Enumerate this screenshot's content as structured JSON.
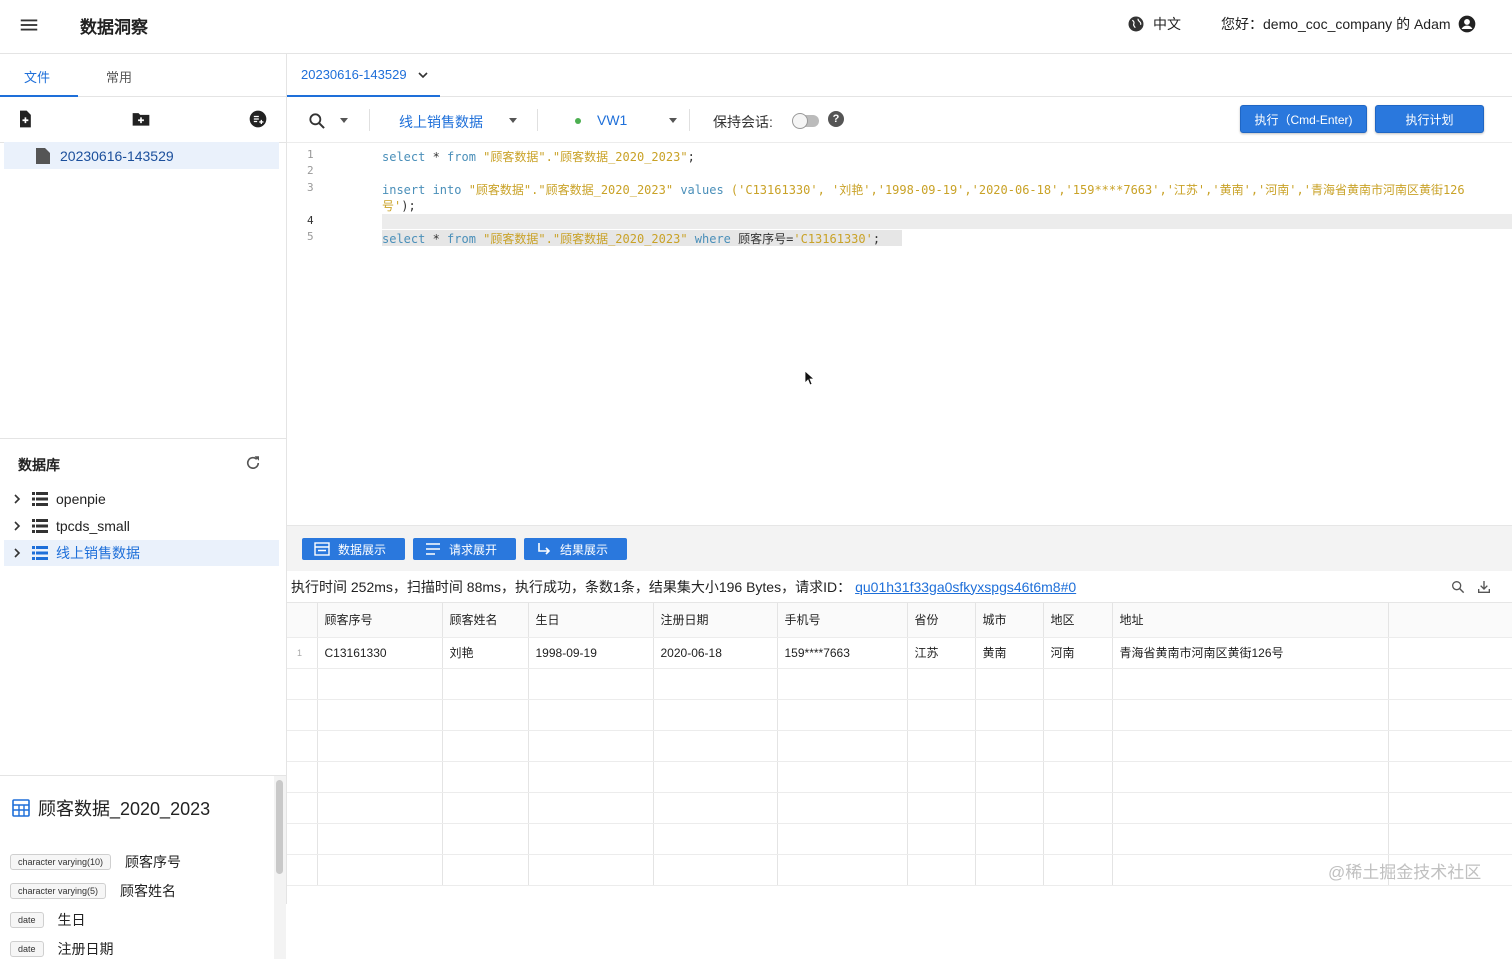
{
  "header": {
    "app_title": "数据洞察",
    "language": "中文",
    "greeting": "您好：demo_coc_company 的 Adam"
  },
  "left_panel": {
    "tabs": [
      {
        "label": "文件"
      },
      {
        "label": "常用"
      }
    ],
    "files": [
      {
        "name": "20230616-143529"
      }
    ],
    "database_title": "数据库",
    "databases": [
      {
        "name": "openpie"
      },
      {
        "name": "tpcds_small"
      },
      {
        "name": "线上销售数据",
        "selected": true
      }
    ],
    "schema": {
      "table_name": "顾客数据_2020_2023",
      "columns": [
        {
          "type": "character varying(10)",
          "name": "顾客序号"
        },
        {
          "type": "character varying(5)",
          "name": "顾客姓名"
        },
        {
          "type": "date",
          "name": "生日"
        },
        {
          "type": "date",
          "name": "注册日期"
        }
      ]
    }
  },
  "editor_tab": {
    "label": "20230616-143529"
  },
  "toolbar": {
    "database": "线上销售数据",
    "warehouse": "VW1",
    "keep_session_label": "保持会话:",
    "keep_session_on": false,
    "help": "?",
    "run_label": "执行（Cmd-Enter)",
    "plan_label": "执行计划"
  },
  "editor": {
    "line_numbers": [
      "1",
      "2",
      "3",
      "",
      "4",
      "5"
    ],
    "lines": {
      "l1_kw1": "select",
      "l1_mid": " * ",
      "l1_kw2": "from",
      "l1_str": " \"顾客数据\".\"顾客数据_2020_2023\"",
      "l1_end": ";",
      "l3_kw1": "insert into",
      "l3_str1": " \"顾客数据\".\"顾客数据_2020_2023\"",
      "l3_kw2": " values",
      "l3_vals": " ('C13161330', '刘艳','1998-09-19','2020-06-18','159****7663','江苏','黄南','河南','青海省黄南市河南区黄街126",
      "l3_cont": "号'",
      "l3_end": ");",
      "l5_kw1": "select",
      "l5_mid": " * ",
      "l5_kw2": "from",
      "l5_str": " \"顾客数据\".\"顾客数据_2020_2023\"",
      "l5_kw3": " where",
      "l5_col": " 顾客序号=",
      "l5_val": "'C13161330'",
      "l5_end": ";"
    }
  },
  "result_tabs": [
    {
      "label": "数据展示"
    },
    {
      "label": "请求展开"
    },
    {
      "label": "结果展示"
    }
  ],
  "status": {
    "text": "执行时间 252ms，扫描时间 88ms，执行成功，条数1条，结果集大小196 Bytes，请求ID：",
    "request_id": "qu01h31f33ga0sfkyxspgs46t6m8#0"
  },
  "results": {
    "columns": [
      "顾客序号",
      "顾客姓名",
      "生日",
      "注册日期",
      "手机号",
      "省份",
      "城市",
      "地区",
      "地址"
    ],
    "rows": [
      {
        "index": "1",
        "cells": [
          "C13161330",
          "刘艳",
          "1998-09-19",
          "2020-06-18",
          "159****7663",
          "江苏",
          "黄南",
          "河南",
          "青海省黄南市河南区黄街126号"
        ]
      }
    ]
  },
  "watermark": "@稀土掘金技术社区",
  "colors": {
    "accent": "#2a78dd",
    "selection_bg": "#eaf1fb",
    "keyword": "#4a8fb9",
    "string": "#c9a227"
  }
}
